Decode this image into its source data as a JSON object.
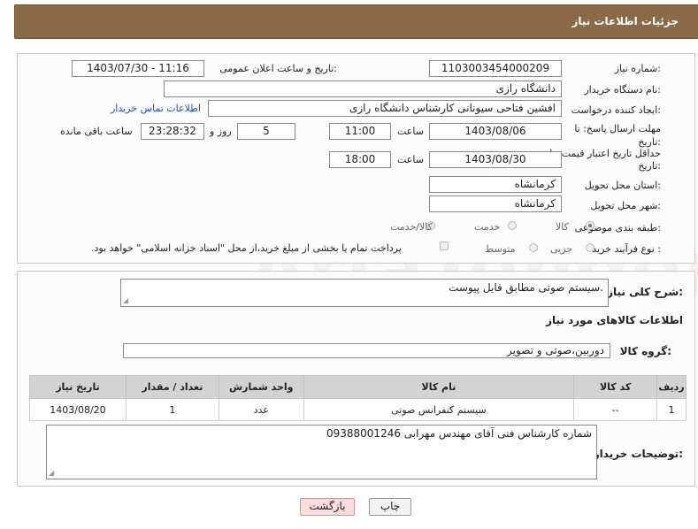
{
  "header": {
    "title": "جزئیات اطلاعات نیاز"
  },
  "form": {
    "need_number_label": "شماره نیاز:",
    "need_number": "1103003454000209",
    "announce_label": "تاریخ و ساعت اعلان عمومی:",
    "announce_value": "1403/07/30 - 11:16",
    "buyer_org_label": "نام دستگاه خریدار:",
    "buyer_org": "دانشگاه رازی",
    "creator_label": "ایجاد کننده درخواست:",
    "creator": "افشین فتاحی سیونانی کارشناس دانشگاه رازی",
    "buyer_contact_link": "اطلاعات تماس خریدار",
    "deadline_label_1": "مهلت ارسال پاسخ: تا",
    "deadline_label_2": "تاریخ:",
    "deadline_date": "1403/08/06",
    "time_label": "ساعت",
    "deadline_time": "11:00",
    "days_count": "5",
    "days_label": "روز و",
    "remaining_time": "23:28:32",
    "remaining_label": "ساعت باقی مانده",
    "validity_label_1": "حداقل تاریخ اعتبار قیمت: تا",
    "validity_label_2": "تاریخ:",
    "validity_date": "1403/08/30",
    "validity_time": "18:00",
    "province_label": "استان محل تحویل:",
    "province": "کرمانشاه",
    "city_label": "شهر محل تحویل:",
    "city": "کرمانشاه",
    "category_label": "طبقه بندی موضوعی:",
    "category_options": [
      "کالا",
      "خدمت",
      "کالا/خدمت"
    ],
    "category_selected": "کالا",
    "process_label": "نوع فرآیند خرید :",
    "process_options": [
      "جزیی",
      "متوسط"
    ],
    "payment_note": "پرداخت تمام یا بخشی از مبلغ خرید،از محل \"اسناد خزانه اسلامی\" خواهد بود."
  },
  "description": {
    "label": "شرح کلی نیاز:",
    "value": "سیستم صوتی مطابق فایل پیوست."
  },
  "goods_info": {
    "title": "اطلاعات کالاهای مورد نیاز",
    "group_label": "گروه کالا:",
    "group_value": "دوربین،صوتی و تصویر"
  },
  "table": {
    "headers": [
      "ردیف",
      "کد کالا",
      "نام کالا",
      "واحد شمارش",
      "تعداد / مقدار",
      "تاریخ نیاز"
    ],
    "rows": [
      [
        "1",
        "--",
        "سیستم کنفرانس صوتی",
        "عدد",
        "1",
        "1403/08/20"
      ]
    ]
  },
  "buyer_notes": {
    "label": "توضیحات خریدار:",
    "value": "شماره کارشناس فنی آقای مهندس مهرابی 09388001246"
  },
  "buttons": {
    "print": "چاپ",
    "back": "بازگشت"
  },
  "watermark": "AriaTender.net",
  "colors": {
    "header_bg": "#8b6a4a",
    "back_button_bg": "#f9dcdc",
    "link": "#1a55b5"
  }
}
